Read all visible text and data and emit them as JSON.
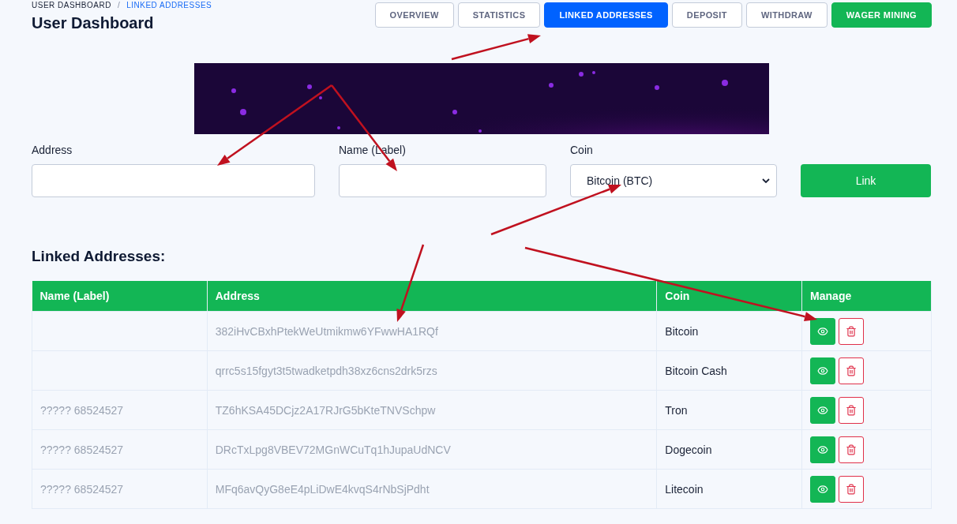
{
  "breadcrumb": {
    "separator": "/",
    "items": [
      {
        "label": "USER DASHBOARD",
        "selected": false
      },
      {
        "label": "LINKED ADDRESSES",
        "selected": true
      }
    ]
  },
  "title": "User Dashboard",
  "tabs": [
    {
      "label": "OVERVIEW",
      "kind": "tab",
      "selected": false
    },
    {
      "label": "STATISTICS",
      "kind": "tab",
      "selected": false
    },
    {
      "label": "LINKED ADDRESSES",
      "kind": "tab",
      "selected": true
    },
    {
      "label": "DEPOSIT",
      "kind": "tab",
      "selected": false
    },
    {
      "label": "WITHDRAW",
      "kind": "tab",
      "selected": false
    },
    {
      "label": "WAGER MINING",
      "kind": "action"
    }
  ],
  "form": {
    "address_label": "Address",
    "name_label": "Name (Label)",
    "coin_label": "Coin",
    "coin_value": "Bitcoin (BTC)",
    "submit": "Link"
  },
  "table": {
    "heading": "Linked Addresses:",
    "columns": [
      "Name (Label)",
      "Address",
      "Coin",
      "Manage"
    ],
    "rows": [
      {
        "name": "",
        "address": "382iHvCBxhPtekWeUtmikmw6YFwwHA1RQf",
        "coin": "Bitcoin"
      },
      {
        "name": "",
        "address": "qrrc5s15fgyt3t5twadketpdh38xz6cns2drk5rzs",
        "coin": "Bitcoin Cash"
      },
      {
        "name": "????? 68524527",
        "address": "TZ6hKSA45DCjz2A17RJrG5bKteTNVSchpw",
        "coin": "Tron"
      },
      {
        "name": "????? 68524527",
        "address": "DRcTxLpg8VBEV72MGnWCuTq1hJupaUdNCV",
        "coin": "Dogecoin"
      },
      {
        "name": "????? 68524527",
        "address": "MFq6avQyG8eE4pLiDwE4kvqS4rNbSjPdht",
        "coin": "Litecoin"
      }
    ]
  }
}
